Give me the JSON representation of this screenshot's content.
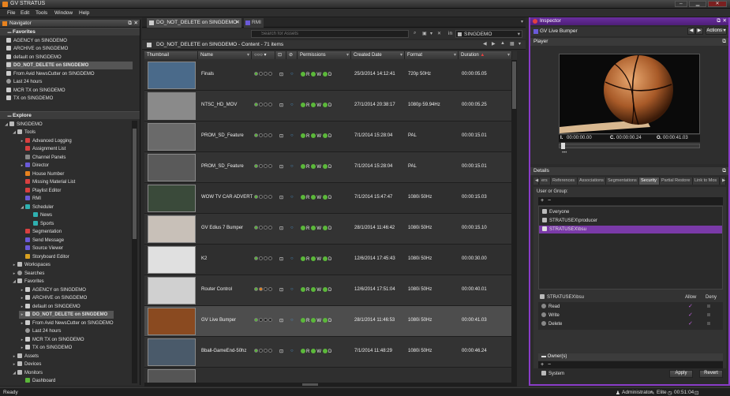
{
  "app": {
    "title": "GV STRATUS"
  },
  "menu": [
    "File",
    "Edit",
    "Tools",
    "Window",
    "Help"
  ],
  "navigator": {
    "title": "Navigator",
    "favorites_label": "Favorites",
    "favorites": [
      "AGENCY on SINGDEMO",
      "ARCHIVE on SINGDEMO",
      "default on SINGDEMO",
      "DO_NOT_DELETE on SINGDEMO",
      "From Avid NewsCutter on SINGDEMO",
      "Last  24 hours",
      "MCR TX on SINGDEMO",
      "TX on SINGDEMO"
    ],
    "explore_label": "Explore",
    "tree": [
      "SINGDEMO",
      "Tools",
      "Advanced Logging",
      "Assignment List",
      "Channel Panels",
      "Director",
      "House Number",
      "Missing Material List",
      "Playlist Editor",
      "RMI",
      "Scheduler",
      "News",
      "Sports",
      "Segmentation",
      "Send Message",
      "Source Viewer",
      "Storyboard Editor",
      "Workspaces",
      "Searches",
      "Favorites",
      "AGENCY on SINGDEMO",
      "ARCHIVE on SINGDEMO",
      "default on SINGDEMO",
      "DO_NOT_DELETE on SINGDEMO",
      "From Avid NewsCutter on SINGDEMO",
      "Last  24 hours",
      "MCR TX on SINGDEMO",
      "TX on SINGDEMO",
      "Assets",
      "Devices",
      "Monitors",
      "Dashboard"
    ]
  },
  "content": {
    "tab1": "DO_NOT_DELETE on SINGDEMO",
    "tab2": "RMI",
    "search_placeholder": "Search for Assets",
    "search_scope_in": "in",
    "search_scope": "SINGDEMO",
    "path": "DO_NOT_DELETE on SINGDEMO  -  Content  -  71 items",
    "columns": [
      "Thumbnail",
      "Name",
      "",
      "",
      "",
      "Permissions",
      "Created Date",
      "Format",
      "Duration"
    ],
    "rows": [
      {
        "name": "Finals",
        "created": "25/3/2014 14:12:41",
        "format": "720p 50Hz",
        "duration": "00:00:05.05"
      },
      {
        "name": "NTSC_HD_MOV",
        "created": "27/1/2014 20:38:17",
        "format": "1080p 59.94Hz",
        "duration": "00:00:05.25"
      },
      {
        "name": "PROM_SD_Feature",
        "created": "7/1/2014 15:28:04",
        "format": "PAL",
        "duration": "00:00:15.01"
      },
      {
        "name": "PROM_SD_Feature",
        "created": "7/1/2014 15:28:04",
        "format": "PAL",
        "duration": "00:00:15.01"
      },
      {
        "name": "WOW TV CAR ADVERT",
        "created": "7/1/2014 15:47:47",
        "format": "1080i 50Hz",
        "duration": "00:00:15.03"
      },
      {
        "name": "GV Edius 7 Bumper",
        "created": "28/1/2014 11:46:42",
        "format": "1080i 50Hz",
        "duration": "00:00:15.10"
      },
      {
        "name": "K2",
        "created": "12/6/2014 17:45:43",
        "format": "1080i 50Hz",
        "duration": "00:00:30.00"
      },
      {
        "name": "Router Control",
        "created": "12/6/2014 17:51:04",
        "format": "1080i 50Hz",
        "duration": "00:00:40.01"
      },
      {
        "name": "GV Live Bumper",
        "created": "28/1/2014 11:46:53",
        "format": "1080i 50Hz",
        "duration": "00:00:41.03"
      },
      {
        "name": "Bball-GameEnd-50hz",
        "created": "7/1/2014 11:48:29",
        "format": "1080i 50Hz",
        "duration": "00:00:46.24"
      },
      {
        "name": "",
        "created": "",
        "format": "",
        "duration": ""
      }
    ],
    "perm_letters": [
      "R",
      "W",
      "D"
    ]
  },
  "inspector": {
    "title": "Inspector",
    "asset_name": "GV Live Bumper",
    "actions_label": "Actions",
    "player_label": "Player",
    "tc_in_label": "I.",
    "tc_in": "00:00:00.00",
    "tc_cur_label": "C.",
    "tc_cur": "00:00:00.24",
    "tc_out_label": "O.",
    "tc_out": "00:00:41.03",
    "details_label": "Details",
    "tabs": [
      "ers",
      "References",
      "Associations",
      "Segmentations",
      "Security",
      "Partial Restore",
      "Link to Mos"
    ],
    "user_or_group": "User or Group:",
    "users": [
      "Everyone",
      "STRATUSEX\\producer",
      "STRATUSEX\\bsu"
    ],
    "selected_user": "STRATUSEX\\bsu",
    "allow_label": "Allow",
    "deny_label": "Deny",
    "permissions": [
      "Read",
      "Write",
      "Delete"
    ],
    "owners_label": "Owner(s)",
    "owners": [
      "System"
    ],
    "apply_label": "Apply",
    "revert_label": "Revert"
  },
  "status": {
    "ready": "Ready",
    "user": "Administrator",
    "license": "Elite",
    "clock": "00:51:04"
  },
  "colors": {
    "accent": "#8a3cc8",
    "perm_green": "#5bb83a",
    "check": "#c060e0"
  }
}
